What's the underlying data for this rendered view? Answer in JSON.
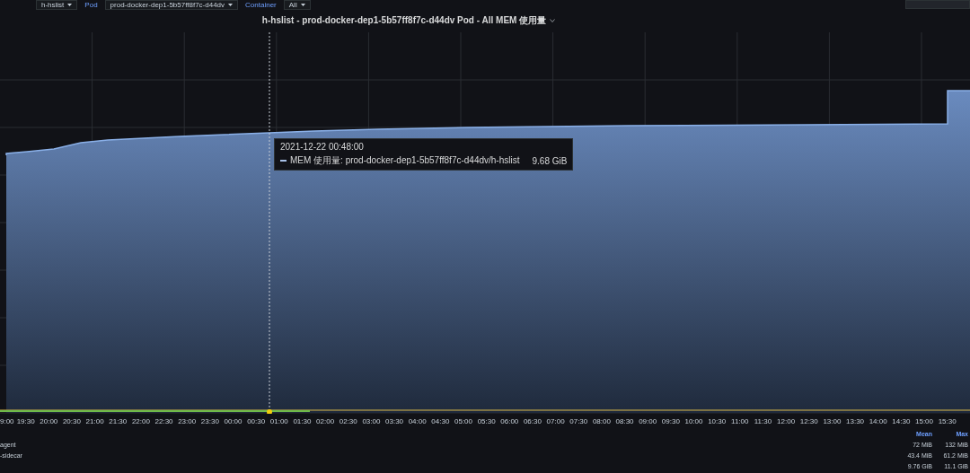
{
  "toolbar": {
    "variables": [
      {
        "label": "Pod",
        "value": "prod-docker-dep1-5b57ff8f7c-d44dv"
      },
      {
        "label": "Container",
        "value": "All"
      }
    ],
    "first_value": "h-hslist"
  },
  "panel": {
    "title": "h-hslist - prod-docker-dep1-5b57ff8f7c-d44dv Pod - All MEM 使用量",
    "x_ticks": [
      "9:00",
      "19:30",
      "20:00",
      "20:30",
      "21:00",
      "21:30",
      "22:00",
      "22:30",
      "23:00",
      "23:30",
      "00:00",
      "00:30",
      "01:00",
      "01:30",
      "02:00",
      "02:30",
      "03:00",
      "03:30",
      "04:00",
      "04:30",
      "05:00",
      "05:30",
      "06:00",
      "06:30",
      "07:00",
      "07:30",
      "08:00",
      "08:30",
      "09:00",
      "09:30",
      "10:00",
      "10:30",
      "11:00",
      "11:30",
      "12:00",
      "12:30",
      "13:00",
      "13:30",
      "14:00",
      "14:30",
      "15:00",
      "15:30"
    ],
    "tooltip": {
      "time": "2021-12-22 00:48:00",
      "series": "MEM 使用量: prod-docker-dep1-5b57ff8f7c-d44dv/h-hslist",
      "value": "9.68 GiB"
    },
    "legend": {
      "columns": [
        "Mean",
        "Max"
      ],
      "rows": [
        {
          "name": "agent",
          "mean": "72 MiB",
          "max": "132 MiB"
        },
        {
          "name": "-sidecar",
          "mean": "43.4 MiB",
          "max": "61.2 MiB"
        },
        {
          "name": "",
          "mean": "9.76 GiB",
          "max": "11.1 GiB"
        }
      ]
    }
  }
}
